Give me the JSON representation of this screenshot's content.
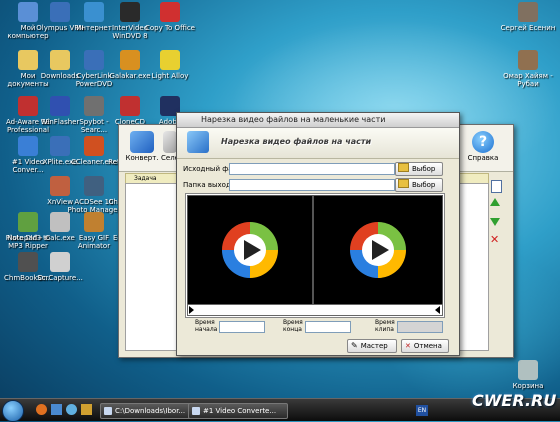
{
  "desktop_left": [
    {
      "label": "Мой компьютер",
      "color": "#5a8fd6"
    },
    {
      "label": "Olympus VPN",
      "color": "#3a6fb8"
    },
    {
      "label": "Интернет",
      "color": "#3a90d0"
    },
    {
      "label": "InterVideo WinDVD 8",
      "color": "#2a2a2a"
    },
    {
      "label": "Copy To Office",
      "color": "#d03030"
    },
    {
      "label": "Мои документы",
      "color": "#e8c860"
    },
    {
      "label": "Downloads",
      "color": "#e8c860"
    },
    {
      "label": "CyberLink PowerDVD",
      "color": "#3a6fb8"
    },
    {
      "label": "Galakar.exe",
      "color": "#d89020"
    },
    {
      "label": "Light Alloy",
      "color": "#e8d030"
    },
    {
      "label": "Ad-Aware SE Professional",
      "color": "#c03030"
    },
    {
      "label": "WinFlasher",
      "color": "#3050b0"
    },
    {
      "label": "Spybot - Searc...",
      "color": "#707070"
    },
    {
      "label": "CloneCD",
      "color": "#c03030"
    },
    {
      "label": "Adobe Photoshop CS3",
      "color": "#203060"
    },
    {
      "label": "#1 Video Conver...",
      "color": "#3a7fd6"
    },
    {
      "label": "XPlite.exe",
      "color": "#3a6fb8"
    },
    {
      "label": "CCleaner.exe",
      "color": "#d05020"
    },
    {
      "label": "Retouch Pl...",
      "color": "#808080"
    },
    {
      "label": "TUGZip",
      "color": "#d0a020"
    },
    {
      "label": "Plato DVD to MP3 Ripper",
      "color": "#5080c0"
    },
    {
      "label": "XnView",
      "color": "#c06040"
    },
    {
      "label": "ACDSee 10 Photo Manager",
      "color": "#406080"
    },
    {
      "label": "CheMax Rus",
      "color": "#303030"
    },
    {
      "label": "PhotoZoom 2",
      "color": "#404040"
    },
    {
      "label": "Notepad++",
      "color": "#60a040"
    },
    {
      "label": "Calc.exe",
      "color": "#c0c0c0"
    },
    {
      "label": "Easy GIF Animator",
      "color": "#c08030"
    },
    {
      "label": "Editor 6.0",
      "color": "#c03030"
    },
    {
      "label": "pmit.exe",
      "color": "#303030"
    },
    {
      "label": "ChmBookOr...",
      "color": "#505050"
    },
    {
      "label": "ScrCapture...",
      "color": "#d0d0d0"
    }
  ],
  "desktop_right": [
    {
      "label": "Сергей Есенин",
      "color": "#807060"
    },
    {
      "label": "Омар Хайям - Рубаи",
      "color": "#907050"
    },
    {
      "label": "Корзина",
      "color": "#b0c0c0"
    }
  ],
  "back_window": {
    "toolbar": [
      "Конверт.",
      "Селе"
    ],
    "help_label": "Справка",
    "list_header": "Задача"
  },
  "dialog": {
    "title": "Нарезка видео файлов на маленькие части",
    "banner": "Нарезка видео файлов на части",
    "source_label": "Исходный файл:",
    "output_label": "Папка выхода:",
    "browse_label": "Выбор",
    "source_value": "",
    "output_value": "",
    "start_label": "Время начала",
    "end_label": "Время конца",
    "time_label": "Время клипа",
    "master_label": "Мастер",
    "cancel_label": "Отмена"
  },
  "taskbar": {
    "tasks": [
      "C:\\Downloads\\Ibor...",
      "#1 Video Converte..."
    ],
    "lang": "EN",
    "watermark": "CWER.RU"
  }
}
